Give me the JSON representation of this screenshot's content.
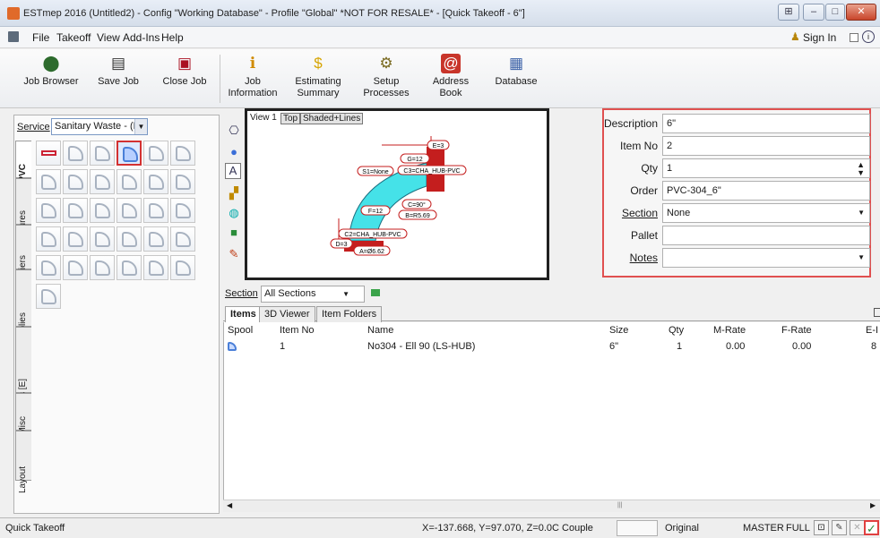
{
  "window": {
    "title": "ESTmep 2016 (Untitled2) - Config \"Working Database\" - Profile \"Global\" *NOT FOR RESALE* - [Quick Takeoff - 6\"]",
    "controls": [
      "⊞",
      "–",
      "□",
      "✕"
    ]
  },
  "menubar": {
    "items": [
      "File",
      "Takeoff",
      "View",
      "Add-Ins",
      "Help"
    ],
    "sign_in": "Sign In"
  },
  "ribbon": {
    "buttons": [
      {
        "label": "Job Browser",
        "icon": "job-browser-icon",
        "glyph": "⬤"
      },
      {
        "label": "Save Job",
        "icon": "save-icon",
        "glyph": "▤"
      },
      {
        "label": "Close Job",
        "icon": "close-job-icon",
        "glyph": "▣"
      },
      {
        "label": "Job Information",
        "line1": "Job",
        "line2": "Information",
        "icon": "info-icon",
        "glyph": "ℹ"
      },
      {
        "label": "Estimating Summary",
        "line1": "Estimating",
        "line2": "Summary",
        "icon": "dollar-icon",
        "glyph": "$"
      },
      {
        "label": "Setup Processes",
        "line1": "Setup",
        "line2": "Processes",
        "icon": "gears-icon",
        "glyph": "⚙"
      },
      {
        "label": "Address Book",
        "line1": "Address",
        "line2": "Book",
        "icon": "address-book-icon",
        "glyph": "@"
      },
      {
        "label": "Database",
        "icon": "database-icon",
        "glyph": "▦"
      }
    ]
  },
  "left_panel": {
    "service_label": "Service",
    "service_value": "Sanitary Waste - (P",
    "tabs": [
      "PVC",
      "Fixtures",
      "Carriers",
      "Assemblies",
      "Supports [E]",
      "Misc",
      "Layout"
    ]
  },
  "viewport": {
    "view_label": "View 1",
    "top_button": "Top",
    "shade_button": "Shaded+Lines"
  },
  "fitting_labels": {
    "e": "E=3",
    "g": "G=12",
    "s1": "S1=None",
    "c3": "C3=CHA_HUB-PVC",
    "c": "C=90°",
    "f": "F=12",
    "b": "B=R5.69",
    "c2": "C2=CHA_HUB-PVC",
    "d": "D=3",
    "a": "A=Ø6.62"
  },
  "properties": {
    "description_label": "Description",
    "description": "6\"",
    "item_no_label": "Item No",
    "item_no": "2",
    "qty_label": "Qty",
    "qty": "1",
    "order_label": "Order",
    "order": "PVC-304_6\"",
    "section_label": "Section",
    "section": "None",
    "pallet_label": "Pallet",
    "pallet": "",
    "notes_label": "Notes",
    "notes": ""
  },
  "section_bar": {
    "label": "Section",
    "value": "All Sections"
  },
  "grid_tabs": [
    "Items",
    "3D Viewer",
    "Item Folders"
  ],
  "grid": {
    "columns": [
      "Spool",
      "Item No",
      "Name",
      "Size",
      "Qty",
      "M-Rate",
      "F-Rate",
      "E-I"
    ],
    "rows": [
      {
        "item_no": "1",
        "name": "No304 - Ell 90 (LS-HUB)",
        "size": "6\"",
        "qty": "1",
        "m_rate": "0.00",
        "f_rate": "0.00",
        "e": "8"
      }
    ]
  },
  "status": {
    "left": "Quick Takeoff",
    "coords": "X=-137.668, Y=97.070, Z=0.0C Couple",
    "mode": "Original",
    "master": "MASTER",
    "full": "FULL"
  }
}
